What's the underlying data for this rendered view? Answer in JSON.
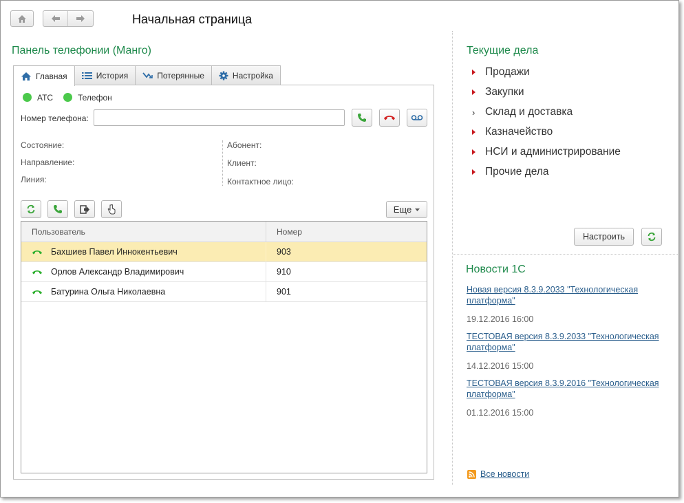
{
  "header": {
    "title": "Начальная страница",
    "home_icon": "home-icon",
    "back_icon": "arrow-left-icon",
    "forward_icon": "arrow-right-icon"
  },
  "telephony": {
    "title": "Панель телефонии (Манго)",
    "tabs": [
      {
        "label": "Главная",
        "icon": "home-icon"
      },
      {
        "label": "История",
        "icon": "list-icon"
      },
      {
        "label": "Потерянные",
        "icon": "missed-call-icon"
      },
      {
        "label": "Настройка",
        "icon": "gear-icon"
      }
    ],
    "status": {
      "ats": "АТС",
      "phone": "Телефон",
      "color": "#4bc94b"
    },
    "phone_label": "Номер телефона:",
    "phone_value": "",
    "info_left": [
      "Состояние:",
      "Направление:",
      "Линия:"
    ],
    "info_right": [
      "Абонент:",
      "Клиент:",
      "Контактное лицо:"
    ],
    "more_label": "Еще",
    "table": {
      "headers": [
        "Пользователь",
        "Номер"
      ],
      "rows": [
        {
          "user": "Бахшиев Павел Иннокентьевич",
          "number": "903",
          "selected": true
        },
        {
          "user": "Орлов Александр Владимирович",
          "number": "910",
          "selected": false
        },
        {
          "user": "Батурина Ольга Николаевна",
          "number": "901",
          "selected": false
        }
      ]
    }
  },
  "current": {
    "title": "Текущие дела",
    "items": [
      "Продажи",
      "Закупки",
      "Склад и доставка",
      "Казначейство",
      "НСИ и администрирование",
      "Прочие дела"
    ],
    "setup_label": "Настроить"
  },
  "news": {
    "title": "Новости 1С",
    "items": [
      {
        "link": "Новая версия 8.3.9.2033 \"Технологическая платформа\"",
        "date": "19.12.2016 16:00"
      },
      {
        "link": "ТЕСТОВАЯ версия 8.3.9.2033 \"Технологическая платформа\"",
        "date": "14.12.2016 15:00"
      },
      {
        "link": "ТЕСТОВАЯ версия 8.3.9.2016 \"Технологическая платформа\"",
        "date": "01.12.2016 15:00"
      }
    ],
    "all_label": "Все новости"
  },
  "colors": {
    "accent": "#1f8a4c",
    "link": "#2a5e8c",
    "selected_row": "#fbecb3",
    "hang_up": "#d32222",
    "call": "#3aa53a"
  }
}
